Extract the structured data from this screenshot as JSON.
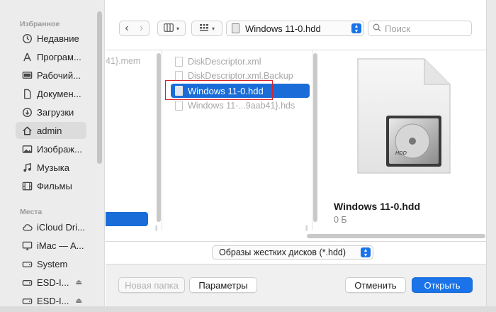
{
  "sidebar": {
    "favorites_header": "Избранное",
    "locations_header": "Места",
    "favorites": [
      {
        "label": "Недавние",
        "icon": "clock-icon"
      },
      {
        "label": "Програм...",
        "icon": "applications-icon"
      },
      {
        "label": "Рабочий...",
        "icon": "desktop-icon"
      },
      {
        "label": "Докумен...",
        "icon": "document-icon"
      },
      {
        "label": "Загрузки",
        "icon": "download-icon"
      },
      {
        "label": "admin",
        "icon": "home-icon"
      },
      {
        "label": "Изображ...",
        "icon": "photo-icon"
      },
      {
        "label": "Музыка",
        "icon": "music-icon"
      },
      {
        "label": "Фильмы",
        "icon": "film-icon"
      }
    ],
    "locations": [
      {
        "label": "iCloud Dri...",
        "icon": "cloud-icon"
      },
      {
        "label": "iMac — A...",
        "icon": "monitor-icon"
      },
      {
        "label": "System",
        "icon": "disk-icon"
      },
      {
        "label": "ESD-I...",
        "icon": "disk-icon"
      },
      {
        "label": "ESD-I...",
        "icon": "disk-icon"
      }
    ]
  },
  "toolbar": {
    "back_glyph": "‹",
    "forward_glyph": "›",
    "path_value": "Windows 11-0.hdd",
    "search_placeholder": "Поиск"
  },
  "browser": {
    "col1_text": "41}.mem",
    "files": [
      {
        "name": "DiskDescriptor.xml",
        "selected": false
      },
      {
        "name": "DiskDescriptor.xml.Backup",
        "selected": false
      },
      {
        "name": "Windows 11-0.hdd",
        "selected": true
      },
      {
        "name": "Windows 11-...9aab41}.hds",
        "selected": false
      }
    ],
    "preview": {
      "name": "Windows 11-0.hdd",
      "size": "0 Б",
      "disk_label": "HDD"
    }
  },
  "format": {
    "selected": "Образы жестких дисков (*.hdd)"
  },
  "footer": {
    "new_folder": "Новая папка",
    "options": "Параметры",
    "cancel": "Отменить",
    "open": "Открыть"
  },
  "colors": {
    "accent": "#1a73e8",
    "selection": "#1a6dd8",
    "highlight_box": "#d8232a"
  }
}
